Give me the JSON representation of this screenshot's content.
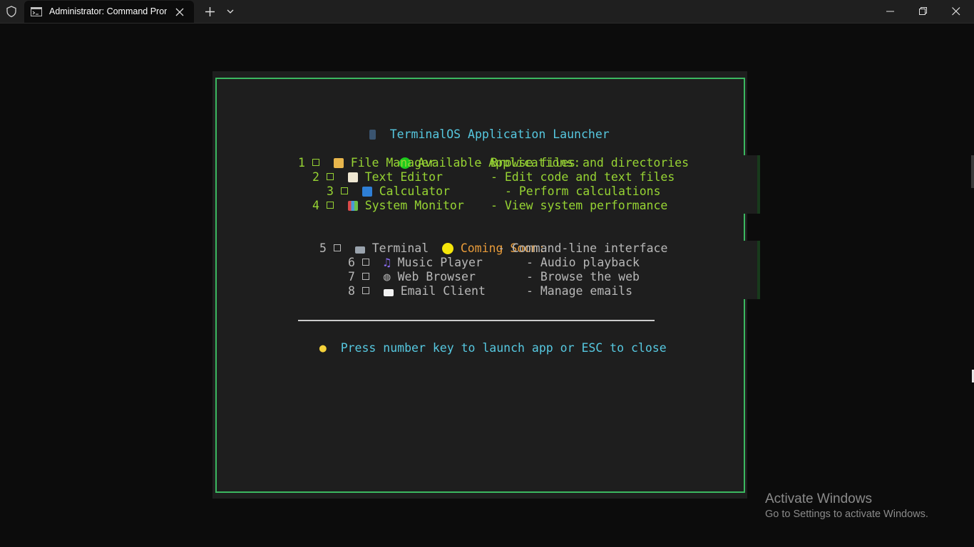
{
  "window": {
    "tab_title": "Administrator: Command Prompt",
    "icons": {
      "shield": "shield-icon",
      "tab": "cmd-icon",
      "close_tab": "close-icon",
      "new_tab": "plus-icon",
      "dropdown": "chevron-down-icon",
      "minimize": "minimize-icon",
      "maximize": "restore-icon",
      "close_window": "close-icon"
    }
  },
  "launcher": {
    "title": "TerminalOS Application Launcher",
    "available_header": "Available Applications:",
    "available": [
      {
        "num": "1",
        "name": "File Manager",
        "desc": "- Browse files and directories",
        "icon": "folder-icon"
      },
      {
        "num": "2",
        "name": "Text Editor",
        "desc": "- Edit code and text files",
        "icon": "memo-icon"
      },
      {
        "num": "3",
        "name": "Calculator",
        "desc": "- Perform calculations",
        "icon": "calculator-icon"
      },
      {
        "num": "4",
        "name": "System Monitor",
        "desc": "- View system performance",
        "icon": "bar-chart-icon"
      }
    ],
    "coming_header": "Coming Soon:",
    "coming": [
      {
        "num": "5",
        "name": "Terminal",
        "desc": "- Command-line interface",
        "icon": "laptop-icon"
      },
      {
        "num": "6",
        "name": "Music Player",
        "desc": "- Audio playback",
        "icon": "music-note-icon"
      },
      {
        "num": "7",
        "name": "Web Browser",
        "desc": "- Browse the web",
        "icon": "globe-icon"
      },
      {
        "num": "8",
        "name": "Email Client",
        "desc": "- Manage emails",
        "icon": "envelope-icon"
      }
    ],
    "hint": "Press number key to launch app or ESC to close",
    "colors": {
      "border": "#3bb860",
      "available_text": "#97d433",
      "coming_header": "#e89b3a",
      "coming_text": "#b8b8b8",
      "title_text": "#56c8e0",
      "green_dot": "#1dc91d",
      "yellow_dot": "#f5e60a"
    }
  },
  "watermark": {
    "line1": "Activate Windows",
    "line2": "Go to Settings to activate Windows."
  }
}
